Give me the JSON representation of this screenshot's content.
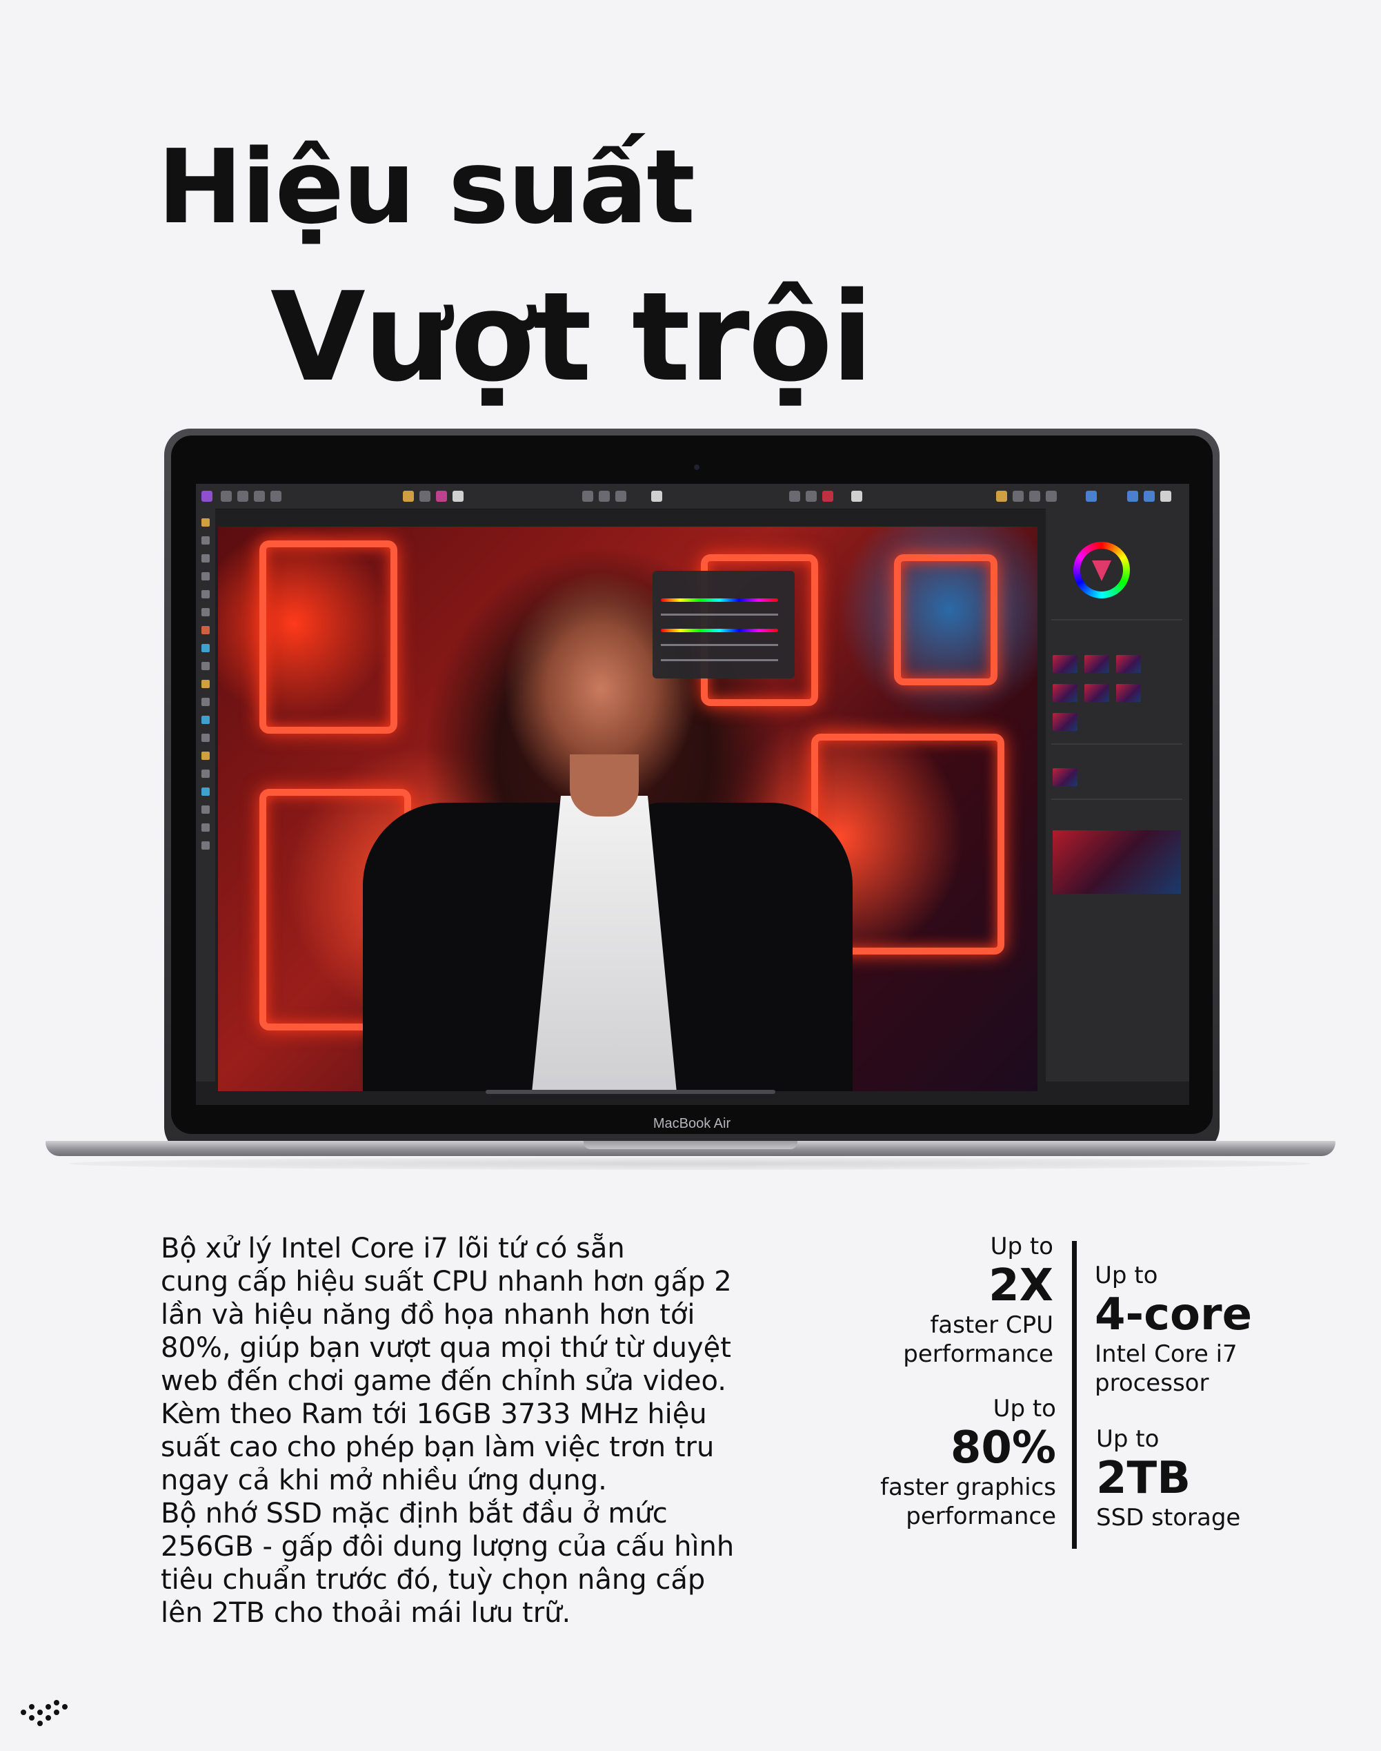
{
  "hero": {
    "title_line1": "Hiệu suất",
    "title_line2": "Vượt trội"
  },
  "laptop": {
    "brand_label": "MacBook Air"
  },
  "description": "Bộ xử lý Intel Core i7 lõi tứ có sẵn\ncung cấp hiệu suất CPU nhanh hơn gấp 2\nlần và hiệu năng đồ họa nhanh hơn tới\n80%, giúp bạn vượt qua mọi thứ từ duyệt\nweb đến chơi game đến chỉnh sửa video.\nKèm theo Ram tới 16GB 3733 MHz hiệu\nsuất cao cho phép bạn làm việc trơn tru\nngay cả khi mở nhiều ứng dụng.\nBộ nhớ SSD mặc định bắt đầu ở mức\n256GB - gấp đôi dung lượng của cấu hình\ntiêu chuẩn trước đó, tuỳ chọn nâng cấp\nlên 2TB cho thoải mái lưu trữ.",
  "stats": {
    "cpu": {
      "prefix": "Up to",
      "value": "2X",
      "line1": "faster CPU",
      "line2": "performance"
    },
    "gpu": {
      "prefix": "Up to",
      "value": "80%",
      "line1": "faster graphics",
      "line2": "performance"
    },
    "core": {
      "prefix": "Up to",
      "value": "4-core",
      "line1": "Intel Core i7",
      "line2": "processor"
    },
    "ssd": {
      "prefix": "Up to",
      "value": "2TB",
      "line1": "SSD storage",
      "line2": ""
    }
  },
  "colors": {
    "background": "#f4f4f6",
    "text": "#111111",
    "neon_accent": "#ff5a3a"
  },
  "icons": {
    "logo": "dot-logo-icon"
  }
}
